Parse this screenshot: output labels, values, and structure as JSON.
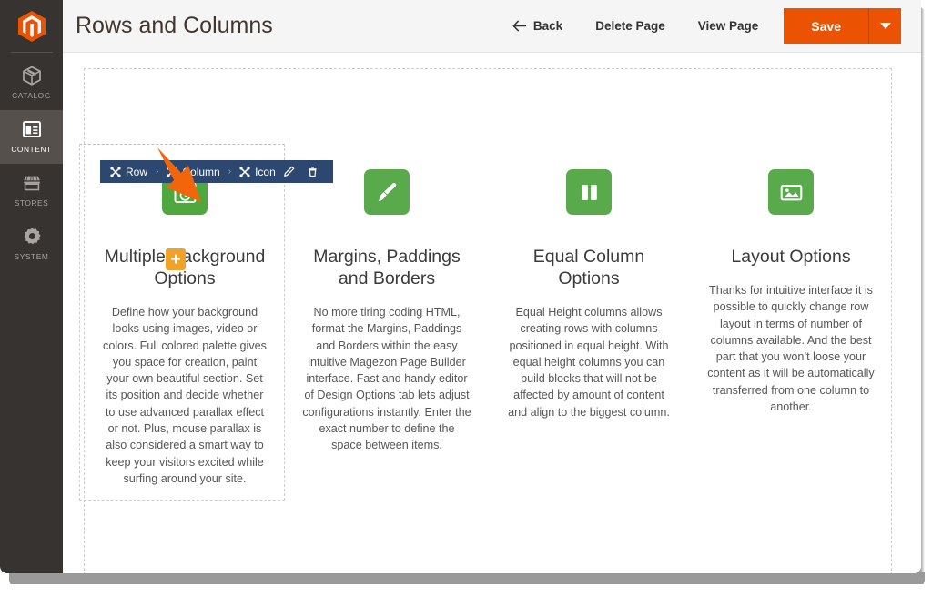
{
  "header": {
    "page_title": "Rows and Columns",
    "buttons": [
      {
        "label": "Back",
        "icon": "back-arrow-icon"
      },
      {
        "label": "Delete Page",
        "icon": ""
      },
      {
        "label": "View Page",
        "icon": ""
      }
    ],
    "save_label": "Save",
    "save_caret_icon": "chevron-down-icon",
    "accent_color": "#eb5202",
    "bg_color": "#f5f5f5"
  },
  "sidebar": {
    "logo_icon": "magento-logo-icon",
    "bg_color": "#373330",
    "active_bg_color": "#55504c",
    "items": [
      {
        "label": "CATALOG",
        "icon": "catalog-box-icon",
        "active": false
      },
      {
        "label": "CONTENT",
        "icon": "content-layout-icon",
        "active": true
      },
      {
        "label": "STORES",
        "icon": "stores-shop-icon",
        "active": false
      },
      {
        "label": "SYSTEM",
        "icon": "system-gear-icon",
        "active": false
      }
    ]
  },
  "element_toolbar": {
    "breadcrumb": [
      {
        "label": "Row",
        "icon": "move-cross-icon"
      },
      {
        "label": "Column",
        "icon": "move-cross-icon"
      },
      {
        "label": "Icon",
        "icon": "move-cross-icon"
      }
    ],
    "separator": "›",
    "actions": [
      {
        "name": "edit",
        "icon": "pencil-icon"
      },
      {
        "name": "delete",
        "icon": "trash-icon"
      }
    ],
    "bg_color": "#2c4770"
  },
  "annotation": {
    "arrow_icon": "arrow-down-right-icon",
    "color": "#f2650a"
  },
  "canvas": {
    "icon_bg_color": "#4fa83d",
    "plus_badge": {
      "symbol": "+",
      "color": "#efa32a"
    },
    "columns": [
      {
        "icon": "browser-window-clock-icon",
        "title_before_badge": "Multiple B",
        "title_after_badge": "ackground Options",
        "title": "Multiple Background Options",
        "has_plus_badge": true,
        "text": "Define how your background looks using images, video or colors. Full colored palette gives you space for creation, paint your own beautiful section. Set its position and decide whether to use advanced parallax effect or not. Plus, mouse parallax is also considered a smart way to keep your visitors excited while surfing around your site."
      },
      {
        "icon": "paint-brush-icon",
        "title": "Margins, Paddings and Borders",
        "has_plus_badge": false,
        "text": "No more tiring coding HTML, format the Margins, Paddings and Borders within the easy intuitive Magezon Page Builder interface. Fast and handy editor of Design Options tab lets adjust configurations instantly. Enter the exact number to define the space between items."
      },
      {
        "icon": "two-columns-icon",
        "title": "Equal Column Options",
        "has_plus_badge": false,
        "text": "Equal Height columns allows creating rows with columns positioned in equal height. With equal height columns you can build blocks that will not be affected by amount of content and align to the biggest column."
      },
      {
        "icon": "image-picture-icon",
        "title": "Layout Options",
        "has_plus_badge": false,
        "text": "Thanks for intuitive interface it is possible to quickly change row layout in terms of number of columns available. And the best part that you won’t loose your content as it will be automatically transferred from one column to another."
      }
    ]
  }
}
